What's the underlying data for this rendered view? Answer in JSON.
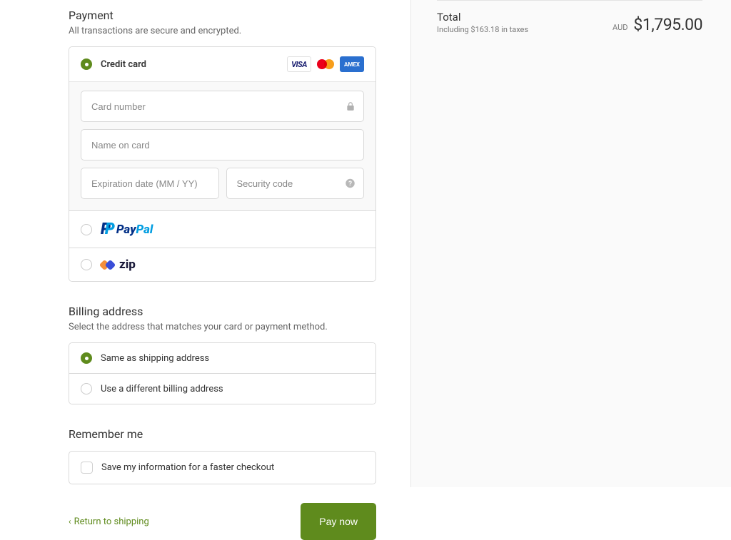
{
  "payment": {
    "title": "Payment",
    "subtitle": "All transactions are secure and encrypted.",
    "methods": {
      "credit_card": "Credit card",
      "paypal": "PayPal",
      "zip": "zip"
    },
    "fields": {
      "card_number": "Card number",
      "name_on_card": "Name on card",
      "expiry": "Expiration date (MM / YY)",
      "cvv": "Security code"
    },
    "brands": {
      "visa": "VISA",
      "amex": "AMEX"
    }
  },
  "billing": {
    "title": "Billing address",
    "subtitle": "Select the address that matches your card or payment method.",
    "same": "Same as shipping address",
    "different": "Use a different billing address"
  },
  "remember": {
    "title": "Remember me",
    "checkbox": "Save my information for a faster checkout"
  },
  "footer": {
    "back": "Return to shipping",
    "pay": "Pay now"
  },
  "summary": {
    "total_label": "Total",
    "taxes_line": "Including $163.18 in taxes",
    "currency": "AUD",
    "amount": "$1,795.00"
  }
}
